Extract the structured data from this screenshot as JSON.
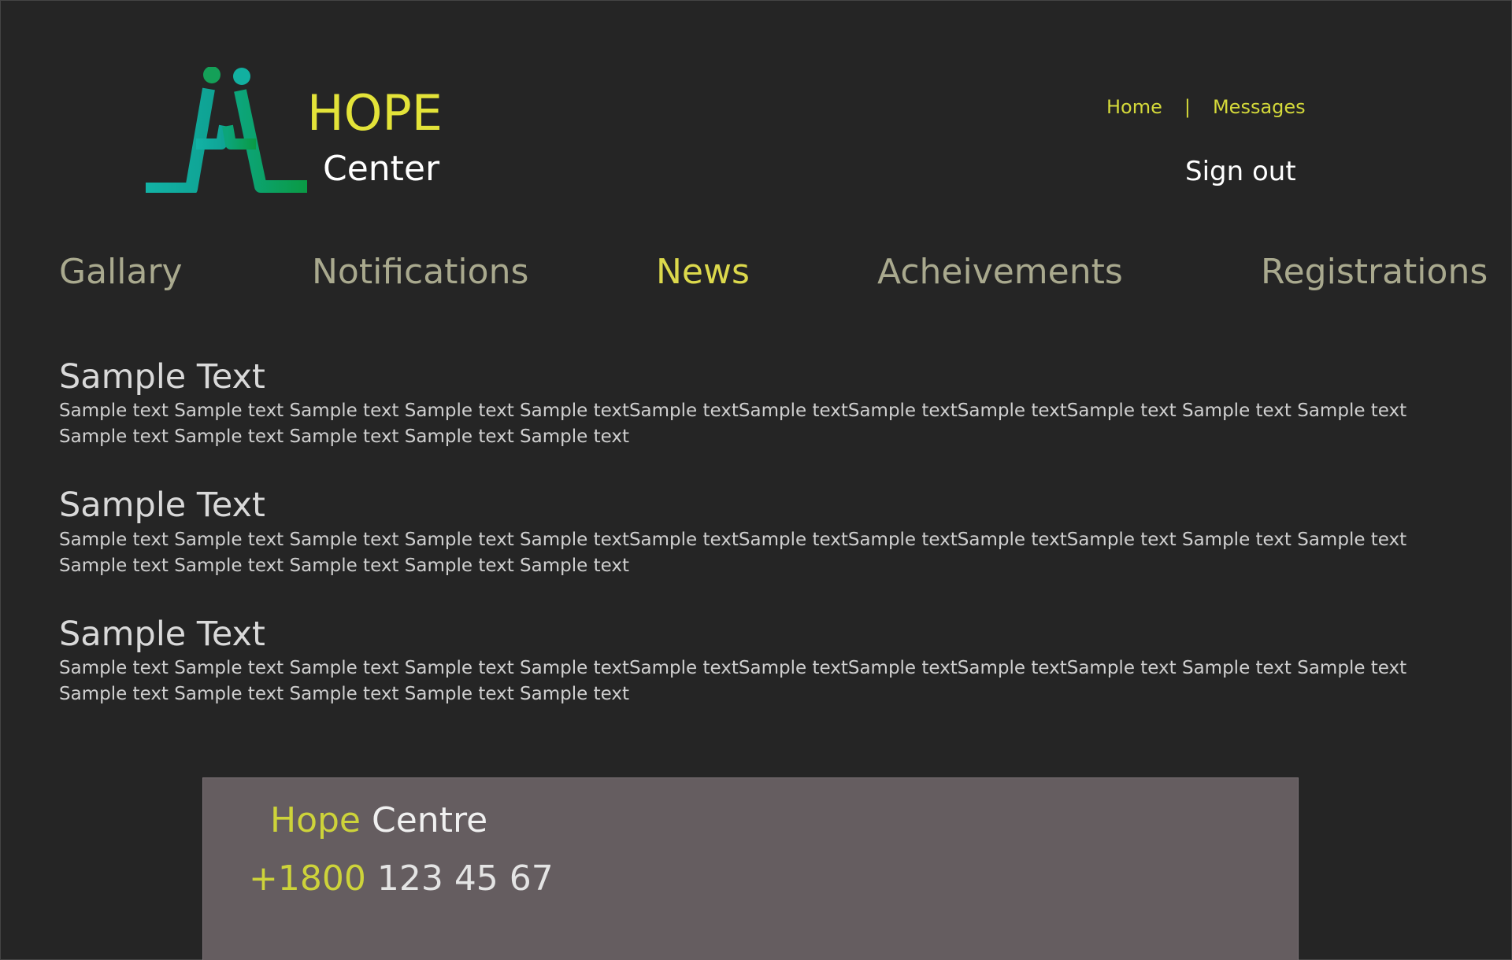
{
  "brand": {
    "name_top": "HOPE",
    "name_bottom": "Center",
    "logo_icon": "two-people-seated-icon"
  },
  "top_links": {
    "home": "Home",
    "separator": "|",
    "messages": "Messages"
  },
  "sign_out": "Sign out",
  "nav": {
    "items": [
      {
        "label": "Gallary",
        "active": false
      },
      {
        "label": "Notifications",
        "active": false
      },
      {
        "label": "News",
        "active": true
      },
      {
        "label": "Acheivements",
        "active": false
      },
      {
        "label": "Registrations",
        "active": false
      }
    ]
  },
  "articles": [
    {
      "title": "Sample Text",
      "body": "Sample text Sample text Sample text Sample text Sample textSample textSample textSample textSample textSample text Sample text Sample text Sample text Sample text Sample text Sample text Sample text"
    },
    {
      "title": "Sample Text",
      "body": "Sample text Sample text Sample text Sample text Sample textSample textSample textSample textSample textSample text Sample text Sample text Sample text Sample text Sample text Sample text Sample text"
    },
    {
      "title": "Sample Text",
      "body": "Sample text Sample text Sample text Sample text Sample textSample textSample textSample textSample textSample text Sample text Sample text Sample text Sample text Sample text Sample text Sample text"
    }
  ],
  "footer": {
    "title_accent": "Hope",
    "title_plain": "Centre",
    "phone_accent": "+1800",
    "phone_plain": "123 45 67"
  },
  "colors": {
    "background": "#252525",
    "accent_yellow": "#e3e339",
    "nav_text": "#a9a98e",
    "footer_bg": "#655d60",
    "logo_teal": "#13b0a0",
    "logo_green": "#0a9a4a"
  }
}
